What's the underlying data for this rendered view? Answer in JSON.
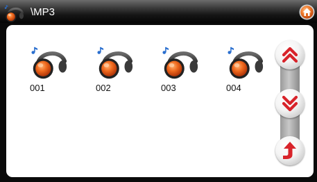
{
  "titlebar": {
    "path": "\\MP3",
    "folder_icon": "headphones-icon",
    "home_icon": "home-icon"
  },
  "files": [
    {
      "name": "001",
      "icon": "music-headphones-icon"
    },
    {
      "name": "002",
      "icon": "music-headphones-icon"
    },
    {
      "name": "003",
      "icon": "music-headphones-icon"
    },
    {
      "name": "004",
      "icon": "music-headphones-icon"
    }
  ],
  "nav": {
    "page_up_icon": "double-chevron-up-icon",
    "page_down_icon": "double-chevron-down-icon",
    "back_icon": "return-arrow-icon"
  },
  "colors": {
    "accent_red": "#d8232a",
    "earcup_orange": "#ec5a12",
    "note_blue": "#2a6fcf",
    "titlebar_dark": "#0a0a0a"
  }
}
